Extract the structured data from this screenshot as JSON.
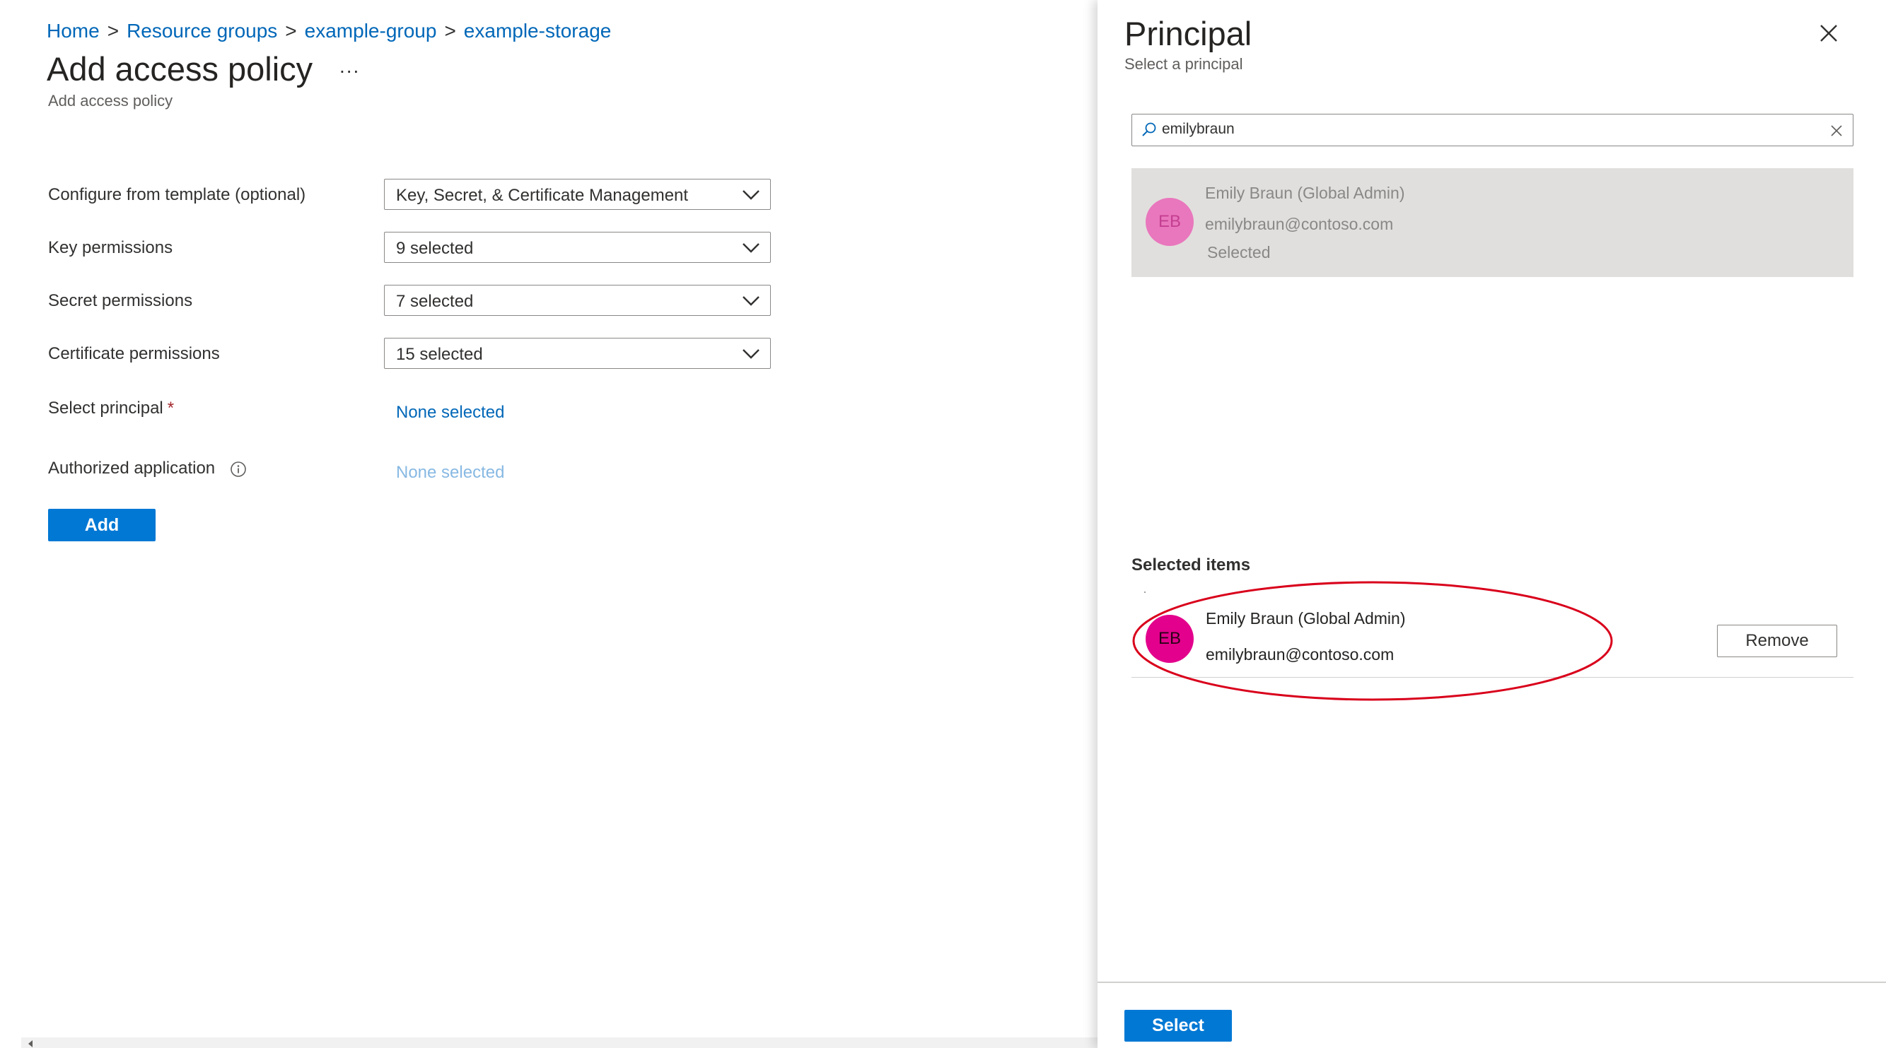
{
  "breadcrumb": {
    "items": [
      "Home",
      "Resource groups",
      "example-group",
      "example-storage"
    ],
    "separator": ">"
  },
  "page": {
    "title": "Add access policy",
    "more": "...",
    "subtitle": "Add access policy"
  },
  "form": {
    "template": {
      "label": "Configure from template (optional)",
      "value": "Key, Secret, & Certificate Management"
    },
    "key_permissions": {
      "label": "Key permissions",
      "value": "9 selected"
    },
    "secret_permissions": {
      "label": "Secret permissions",
      "value": "7 selected"
    },
    "certificate_permissions": {
      "label": "Certificate permissions",
      "value": "15 selected"
    },
    "principal": {
      "label": "Select principal",
      "required_marker": "*",
      "value": "None selected"
    },
    "authorized_app": {
      "label": "Authorized application",
      "value": "None selected"
    },
    "add_label": "Add"
  },
  "panel": {
    "title": "Principal",
    "subtitle": "Select a principal",
    "search": {
      "value": "emilybraun"
    },
    "result": {
      "initials": "EB",
      "name": "Emily Braun (Global Admin)",
      "email": "emilybraun@contoso.com",
      "status": "Selected"
    },
    "selected_items": {
      "heading": "Selected items",
      "items": [
        {
          "initials": "EB",
          "name": "Emily Braun (Global Admin)",
          "email": "emilybraun@contoso.com",
          "remove_label": "Remove"
        }
      ]
    },
    "select_label": "Select"
  },
  "colors": {
    "accent": "#0078d4",
    "link": "#0067b8",
    "avatar_selected": "#e3008c",
    "avatar_result": "#e977bd",
    "highlight": "#d9001b"
  },
  "icons": [
    "more-icon",
    "info-icon",
    "chevron-down-icon",
    "close-icon",
    "search-icon",
    "clear-icon"
  ]
}
